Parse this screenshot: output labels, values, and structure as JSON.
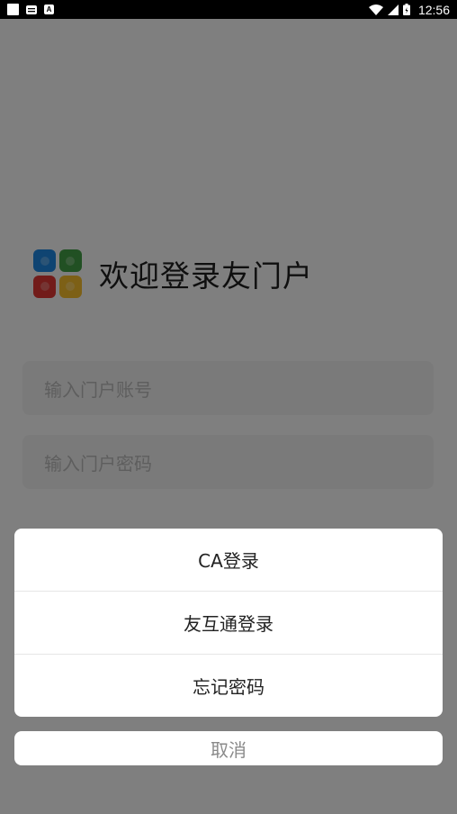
{
  "status_bar": {
    "time": "12:56",
    "left_icons": [
      "notification-square-icon",
      "message-icon",
      "a-icon"
    ],
    "right_icons": [
      "wifi-icon",
      "signal-icon",
      "battery-icon"
    ]
  },
  "login": {
    "welcome_text": "欢迎登录友门户",
    "account_placeholder": "输入门户账号",
    "password_placeholder": "输入门户密码"
  },
  "action_sheet": {
    "items": [
      {
        "label": "CA登录"
      },
      {
        "label": "友互通登录"
      },
      {
        "label": "忘记密码"
      }
    ],
    "cancel_label": "取消"
  },
  "colors": {
    "status_bar": "#000000",
    "overlay": "rgba(0,0,0,0.5)",
    "logo_blue": "#1e88e5",
    "logo_green": "#43a047",
    "logo_red": "#e53935",
    "logo_yellow": "#fbc02d"
  }
}
